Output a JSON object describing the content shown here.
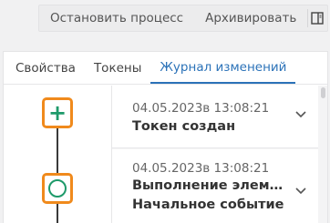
{
  "toolbar": {
    "stop_process_label": "Остановить процесс",
    "archive_label": "Архивировать",
    "panel_toggle_icon": "panel-toggle-icon"
  },
  "tabs": [
    {
      "label": "Свойства",
      "active": false
    },
    {
      "label": "Токены",
      "active": false
    },
    {
      "label": "Журнал изменений",
      "active": true
    }
  ],
  "timeline": {
    "nodes": [
      {
        "icon": "plus-icon",
        "color": "#1e9a6a",
        "highlight": "#f08a1c"
      },
      {
        "icon": "start-event-circle-icon",
        "color": "#1e9a6a",
        "highlight": "#f08a1c"
      }
    ]
  },
  "events": [
    {
      "date": "04.05.2023в 13:08:21",
      "title": "Токен создан",
      "subtitle": ""
    },
    {
      "date": "04.05.2023в 13:08:21",
      "title": "Выполнение элем…",
      "subtitle": "Начальное событие"
    }
  ],
  "colors": {
    "accent": "#2b72b8",
    "highlight": "#f08a1c",
    "node_green": "#1e9a6a"
  }
}
